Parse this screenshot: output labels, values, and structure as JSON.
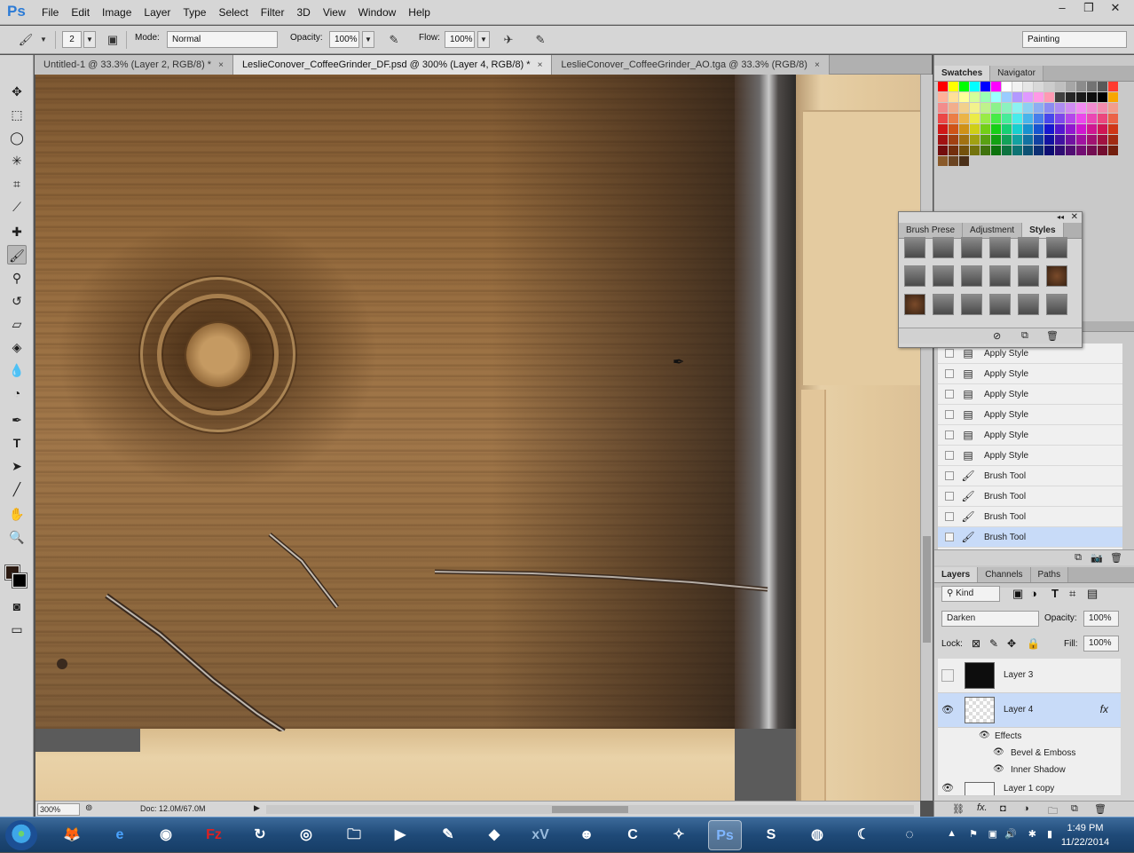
{
  "app": {
    "logo": "Ps"
  },
  "menu": [
    "File",
    "Edit",
    "Image",
    "Layer",
    "Type",
    "Select",
    "Filter",
    "3D",
    "View",
    "Window",
    "Help"
  ],
  "window_controls": {
    "minimize": "–",
    "restore": "❐",
    "close": "✕"
  },
  "options": {
    "brush_size": "2",
    "mode_label": "Mode:",
    "mode_value": "Normal",
    "opacity_label": "Opacity:",
    "opacity_value": "100%",
    "flow_label": "Flow:",
    "flow_value": "100%",
    "workspace": "Painting"
  },
  "tabs": [
    {
      "label": "Untitled-1 @ 33.3% (Layer 2, RGB/8) *",
      "close": "×"
    },
    {
      "label": "LeslieConover_CoffeeGrinder_DF.psd @ 300% (Layer 4, RGB/8) *",
      "close": "×"
    },
    {
      "label": "LeslieConover_CoffeeGrinder_AO.tga @ 33.3% (RGB/8)",
      "close": "×"
    }
  ],
  "status": {
    "zoom": "300%",
    "doc": "Doc: 12.0M/67.0M"
  },
  "panels": {
    "swatches_tabs": [
      "Swatches",
      "Navigator"
    ],
    "styles_tabs": [
      "Brush Prese",
      "Adjustment",
      "Styles"
    ],
    "history_items": [
      {
        "label": "Apply Style",
        "icon": "document-icon"
      },
      {
        "label": "Apply Style",
        "icon": "document-icon"
      },
      {
        "label": "Apply Style",
        "icon": "document-icon"
      },
      {
        "label": "Apply Style",
        "icon": "document-icon"
      },
      {
        "label": "Apply Style",
        "icon": "document-icon"
      },
      {
        "label": "Apply Style",
        "icon": "document-icon"
      },
      {
        "label": "Brush Tool",
        "icon": "brush-icon"
      },
      {
        "label": "Brush Tool",
        "icon": "brush-icon"
      },
      {
        "label": "Brush Tool",
        "icon": "brush-icon"
      },
      {
        "label": "Brush Tool",
        "icon": "brush-icon"
      }
    ],
    "layers_tabs": [
      "Layers",
      "Channels",
      "Paths"
    ],
    "kind_label": "Kind",
    "blend_mode": "Darken",
    "opacity_label": "Opacity:",
    "opacity_value": "100%",
    "lock_label": "Lock:",
    "fill_label": "Fill:",
    "fill_value": "100%",
    "layers": [
      {
        "name": "Layer 3"
      },
      {
        "name": "Layer 4",
        "fx": "fx"
      }
    ],
    "effects_label": "Effects",
    "effects": [
      "Bevel & Emboss",
      "Inner Shadow"
    ],
    "last_layer": "Layer 1 copy"
  },
  "taskbar": {
    "time": "1:49 PM",
    "date": "11/22/2014"
  }
}
